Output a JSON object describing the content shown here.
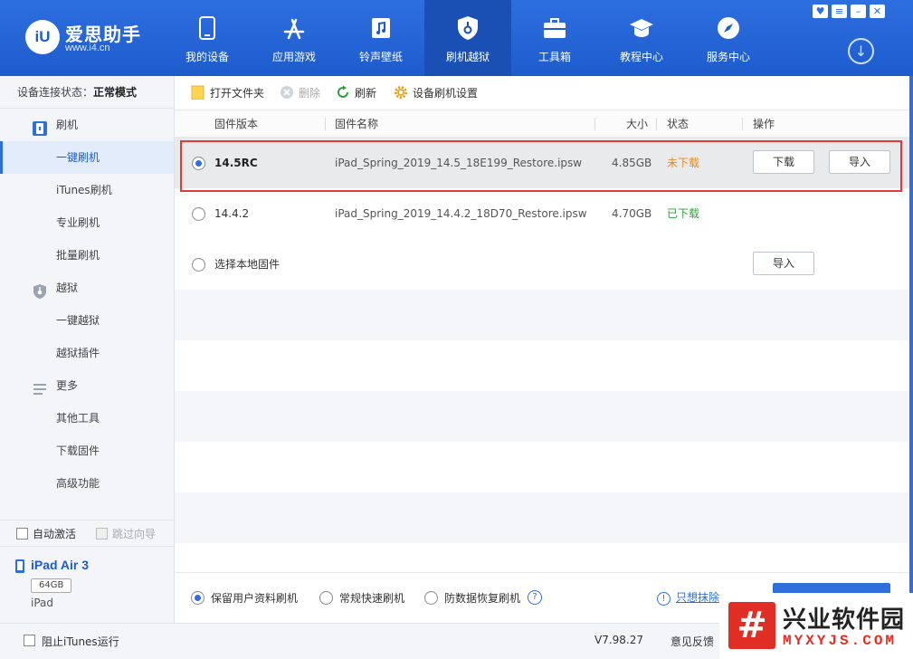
{
  "app": {
    "logo_mark": "iU",
    "name": "爱思助手",
    "url": "www.i4.cn"
  },
  "nav": [
    {
      "label": "我的设备",
      "icon": "phone-icon"
    },
    {
      "label": "应用游戏",
      "icon": "app-store-icon"
    },
    {
      "label": "铃声壁纸",
      "icon": "music-file-icon"
    },
    {
      "label": "刷机越狱",
      "icon": "shield-icon",
      "active": true
    },
    {
      "label": "工具箱",
      "icon": "toolbox-icon"
    },
    {
      "label": "教程中心",
      "icon": "graduation-cap-icon"
    },
    {
      "label": "服务中心",
      "icon": "compass-icon"
    }
  ],
  "window_buttons": [
    "shirt-icon",
    "menu-icon",
    "minimize-icon",
    "close-icon"
  ],
  "window_button_glyphs": [
    "♥",
    "≡",
    "–",
    "✕"
  ],
  "sidebar": {
    "status_label": "设备连接状态：",
    "status_value": "正常模式",
    "groups": [
      {
        "label": "刷机",
        "icon": "flash-icon",
        "items": [
          "一键刷机",
          "iTunes刷机",
          "专业刷机",
          "批量刷机"
        ]
      },
      {
        "label": "越狱",
        "icon": "jailbreak-shield-icon",
        "items": [
          "一键越狱",
          "越狱插件"
        ]
      },
      {
        "label": "更多",
        "icon": "list-icon",
        "items": [
          "其他工具",
          "下载固件",
          "高级功能"
        ]
      }
    ],
    "active_item": "一键刷机",
    "auto_activate": "自动激活",
    "skip_guide": "跳过向导",
    "device": {
      "name": "iPad Air 3",
      "capacity": "64GB",
      "type": "iPad"
    }
  },
  "toolbar": {
    "open_folder": "打开文件夹",
    "delete": "删除",
    "refresh": "刷新",
    "settings": "设备刷机设置"
  },
  "table": {
    "headers": {
      "version": "固件版本",
      "name": "固件名称",
      "size": "大小",
      "status": "状态",
      "action": "操作"
    },
    "rows": [
      {
        "version": "14.5RC",
        "name": "iPad_Spring_2019_14.5_18E199_Restore.ipsw",
        "size": "4.85GB",
        "status": "未下载",
        "status_color": "#e88a1a",
        "selected": true,
        "actions": [
          "下载",
          "导入"
        ]
      },
      {
        "version": "14.4.2",
        "name": "iPad_Spring_2019_14.4.2_18D70_Restore.ipsw",
        "size": "4.70GB",
        "status": "已下载",
        "status_color": "#2e9e3a",
        "selected": false,
        "actions": []
      },
      {
        "version": "选择本地固件",
        "name": "",
        "size": "",
        "status": "",
        "status_color": "#333333",
        "selected": false,
        "actions": [
          "导入"
        ]
      }
    ]
  },
  "bottom": {
    "options": [
      "保留用户资料刷机",
      "常规快速刷机",
      "防数据恢复刷机"
    ],
    "selected_option": 0,
    "erase_link": "只想抹除"
  },
  "statusbar": {
    "block_itunes": "阻止iTunes运行",
    "version": "V7.98.27",
    "feedback": "意见反馈"
  },
  "watermark": {
    "icon": "#",
    "title": "兴业软件园",
    "url": "MYXYJS.COM"
  },
  "colors": {
    "header": "#2d6ee0",
    "accent": "#2f6fdc",
    "highlight_border": "#e53935",
    "not_downloaded": "#e88a1a",
    "downloaded": "#2e9e3a"
  }
}
